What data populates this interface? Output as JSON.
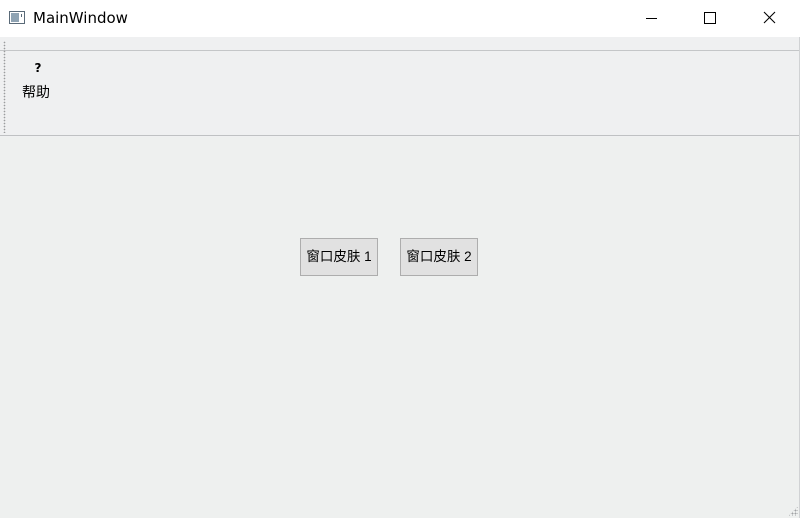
{
  "window": {
    "title": "MainWindow"
  },
  "toolbar": {
    "help": {
      "icon_glyph": "?",
      "label": "帮助"
    }
  },
  "central": {
    "buttons": [
      {
        "label": "窗口皮肤 1"
      },
      {
        "label": "窗口皮肤 2"
      }
    ]
  },
  "colors": {
    "window_background": "#eff0f1",
    "button_background": "#e1e1e1",
    "button_border": "#adadad"
  }
}
